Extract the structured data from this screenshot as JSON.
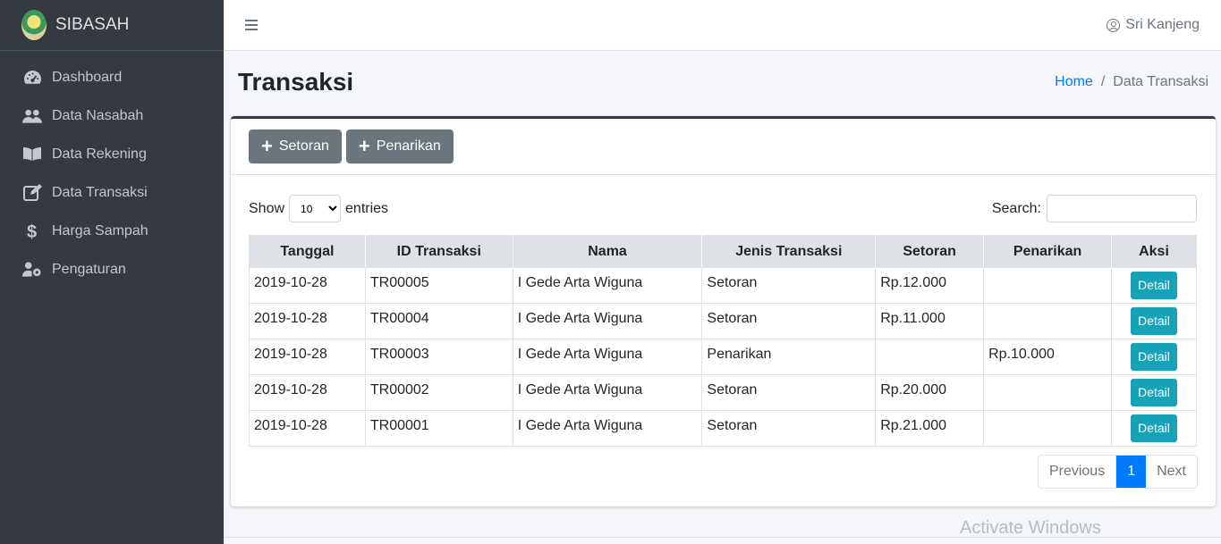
{
  "brand": {
    "name": "SIBASAH"
  },
  "sidebar": {
    "items": [
      {
        "label": "Dashboard",
        "icon": "dashboard-icon"
      },
      {
        "label": "Data Nasabah",
        "icon": "users-icon"
      },
      {
        "label": "Data Rekening",
        "icon": "book-icon"
      },
      {
        "label": "Data Transaksi",
        "icon": "edit-icon"
      },
      {
        "label": "Harga Sampah",
        "icon": "dollar-icon"
      },
      {
        "label": "Pengaturan",
        "icon": "user-cog-icon"
      }
    ]
  },
  "topbar": {
    "user": "Sri Kanjeng"
  },
  "header": {
    "title": "Transaksi",
    "breadcrumb_home": "Home",
    "breadcrumb_sep": "/",
    "breadcrumb_current": "Data Transaksi"
  },
  "actions": {
    "setoran": "Setoran",
    "penarikan": "Penarikan",
    "plus": "+"
  },
  "table_controls": {
    "show": "Show",
    "entries": "entries",
    "length_value": "10",
    "search_label": "Search:"
  },
  "table": {
    "columns": [
      "Tanggal",
      "ID Transaksi",
      "Nama",
      "Jenis Transaksi",
      "Setoran",
      "Penarikan",
      "Aksi"
    ],
    "rows": [
      [
        "2019-10-28",
        "TR00005",
        "I Gede Arta Wiguna",
        "Setoran",
        "Rp.12.000",
        "",
        "Detail"
      ],
      [
        "2019-10-28",
        "TR00004",
        "I Gede Arta Wiguna",
        "Setoran",
        "Rp.11.000",
        "",
        "Detail"
      ],
      [
        "2019-10-28",
        "TR00003",
        "I Gede Arta Wiguna",
        "Penarikan",
        "",
        "Rp.10.000",
        "Detail"
      ],
      [
        "2019-10-28",
        "TR00002",
        "I Gede Arta Wiguna",
        "Setoran",
        "Rp.20.000",
        "",
        "Detail"
      ],
      [
        "2019-10-28",
        "TR00001",
        "I Gede Arta Wiguna",
        "Setoran",
        "Rp.21.000",
        "",
        "Detail"
      ]
    ]
  },
  "pagination": {
    "previous": "Previous",
    "current": "1",
    "next": "Next"
  },
  "watermark": "Activate Windows",
  "colors": {
    "sidebar": "#343a40",
    "primary": "#007bff",
    "info": "#17a2b8",
    "secondary": "#6c757d"
  }
}
